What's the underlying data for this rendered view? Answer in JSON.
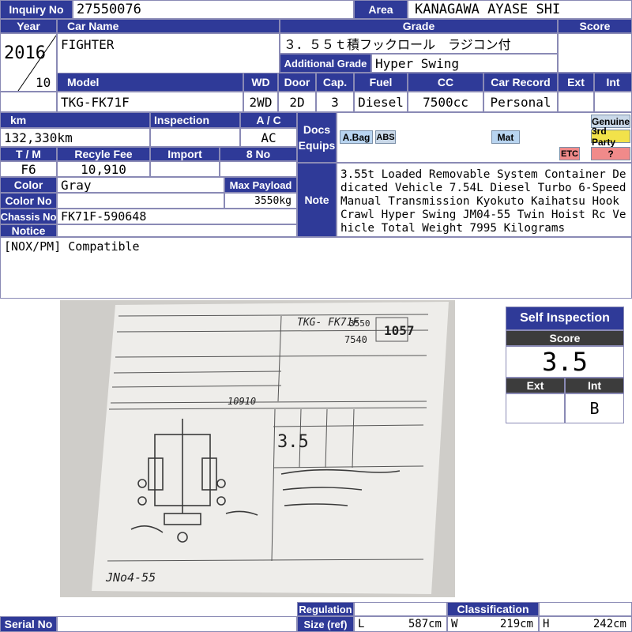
{
  "labels": {
    "inquiry_no": "Inquiry No",
    "area": "Area",
    "year": "Year",
    "car_name": "Car Name",
    "grade": "Grade",
    "score": "Score",
    "additional_grade": "Additional Grade",
    "model": "Model",
    "wd": "WD",
    "door": "Door",
    "cap": "Cap.",
    "fuel": "Fuel",
    "cc": "CC",
    "car_record": "Car Record",
    "ext": "Ext",
    "int": "Int",
    "km": "km",
    "inspection": "Inspection",
    "ac": "A / C",
    "docs": "Docs",
    "equips": "Equips",
    "tm": "T / M",
    "recycle_fee": "Recyle Fee",
    "import": "Import",
    "eight_no": "8 No",
    "color": "Color",
    "max_payload": "Max Payload",
    "color_no": "Color No",
    "note": "Note",
    "chassis_no": "Chassis No",
    "notice": "Notice",
    "serial_no": "Serial No",
    "regulation": "Regulation",
    "size_ref": "Size (ref)",
    "classification": "Classification",
    "l": "L",
    "w": "W",
    "h": "H"
  },
  "vehicle": {
    "inquiry_no": "27550076",
    "area": "KANAGAWA AYASE SHI",
    "year": "2016",
    "month": "10",
    "car_name": "FIGHTER",
    "grade": "３．５５ｔ積フックロール　ラジコン付",
    "additional_grade": "Hyper Swing",
    "model": "TKG-FK71F",
    "wd": "2WD",
    "door": "2D",
    "cap": "3",
    "fuel": "Diesel",
    "cc": "7500cc",
    "car_record": "Personal",
    "km": "132,330km",
    "ac": "AC",
    "tm": "F6",
    "recycle_fee": "10,910",
    "color": "Gray",
    "max_payload": "3550kg",
    "chassis_no": "FK71F-590648",
    "note": "3.55t Loaded Removable System Container Dedicated Vehicle 7.54L Diesel Turbo 6-Speed Manual Transmission Kyokuto Kaihatsu Hook Crawl Hyper Swing JM04-55 Twin Hoist Rc Vehicle Total Weight 7995 Kilograms",
    "notice": "[NOX/PM] Compatible",
    "size_l": "587cm",
    "size_w": "219cm",
    "size_h": "242cm"
  },
  "equip_badges": {
    "airbag": "A.Bag",
    "abs": "ABS",
    "mat": "Mat",
    "genuine": "Genuine",
    "third_party": "3rd Party",
    "etc": "ETC",
    "unknown": "?"
  },
  "self_inspection": {
    "title": "Self Inspection",
    "score_label": "Score",
    "score": "3.5",
    "ext_label": "Ext",
    "int_label": "Int",
    "ext": "",
    "int": "B"
  },
  "sheet_photo": {
    "lot_no": "1057",
    "score": "3.5",
    "model": "TKG- FK71F",
    "payload_a": "3550",
    "payload_b": "7540",
    "recycle": "10910",
    "hoist": "JNo4-55"
  },
  "colors": {
    "header": "#2f3a98",
    "border": "#8a8ab5",
    "badge_blue": "#b8d4f0",
    "badge_yellow": "#f2e24a",
    "badge_red": "#f08a8a",
    "badge_grey": "#c9d8e8"
  }
}
